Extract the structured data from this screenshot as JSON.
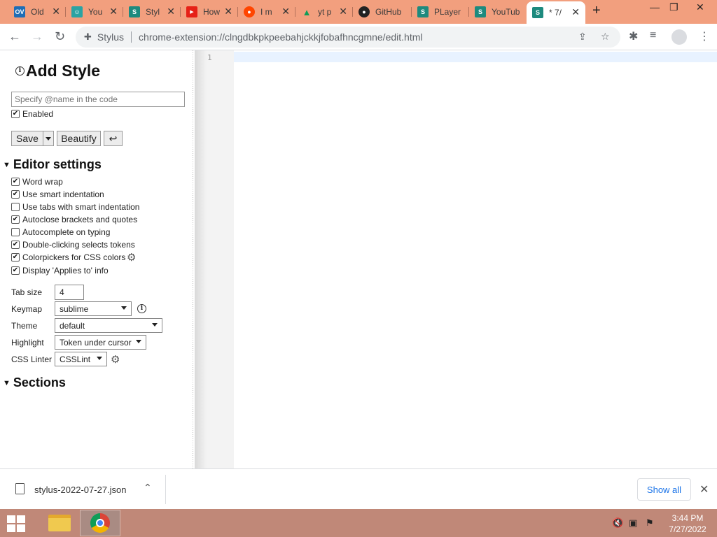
{
  "tabs": [
    {
      "title": "Old",
      "icon": "ov-icon",
      "color": "#1f6db5",
      "glyph": "OV"
    },
    {
      "title": "You",
      "icon": "face-icon",
      "color": "#2aa3a3",
      "glyph": "☺"
    },
    {
      "title": "Styl",
      "icon": "stylus-icon",
      "color": "#1d8a7e",
      "glyph": "S"
    },
    {
      "title": "How",
      "icon": "youtube-icon",
      "color": "#e62117",
      "glyph": "▶"
    },
    {
      "title": "I m",
      "icon": "reddit-icon",
      "color": "#ff4500",
      "glyph": "●"
    },
    {
      "title": "yt p",
      "icon": "drive-icon",
      "color": "#0f9d58",
      "glyph": "▲"
    },
    {
      "title": "GitHub",
      "icon": "github-icon",
      "color": "#222222",
      "glyph": "●"
    },
    {
      "title": "PLayer",
      "icon": "stylus-icon",
      "color": "#1d8a7e",
      "glyph": "S"
    },
    {
      "title": "YouTub",
      "icon": "stylus-icon",
      "color": "#1d8a7e",
      "glyph": "S"
    },
    {
      "title": "* 7/",
      "icon": "stylus-icon",
      "color": "#1d8a7e",
      "glyph": "S"
    }
  ],
  "toolbar": {
    "site_label": "Stylus",
    "url": "chrome-extension://clngdbkpkpeebahjckkjfobafhncgmne/edit.html"
  },
  "sidebar": {
    "title": "Add Style",
    "name_placeholder": "Specify @name in the code",
    "enabled_label": "Enabled",
    "enabled_checked": true,
    "save_label": "Save",
    "beautify_label": "Beautify",
    "undo_glyph": "↩",
    "editor_settings_heading": "Editor settings",
    "options": [
      {
        "label": "Word wrap",
        "checked": true
      },
      {
        "label": "Use smart indentation",
        "checked": true
      },
      {
        "label": "Use tabs with smart indentation",
        "checked": false
      },
      {
        "label": "Autoclose brackets and quotes",
        "checked": true
      },
      {
        "label": "Autocomplete on typing",
        "checked": false
      },
      {
        "label": "Double-clicking selects tokens",
        "checked": true
      },
      {
        "label": "Colorpickers for CSS colors",
        "checked": true
      },
      {
        "label": "Display 'Applies to' info",
        "checked": true
      }
    ],
    "tab_size_label": "Tab size",
    "tab_size_value": "4",
    "keymap_label": "Keymap",
    "keymap_value": "sublime",
    "theme_label": "Theme",
    "theme_value": "default",
    "highlight_label": "Highlight",
    "highlight_value": "Token under cursor",
    "linter_label": "CSS Linter",
    "linter_value": "CSSLint",
    "sections_heading": "Sections"
  },
  "editor": {
    "line_number": "1"
  },
  "downloads": {
    "file_name": "stylus-2022-07-27.json",
    "show_all_label": "Show all"
  },
  "taskbar": {
    "time": "3:44 PM",
    "date": "7/27/2022"
  }
}
